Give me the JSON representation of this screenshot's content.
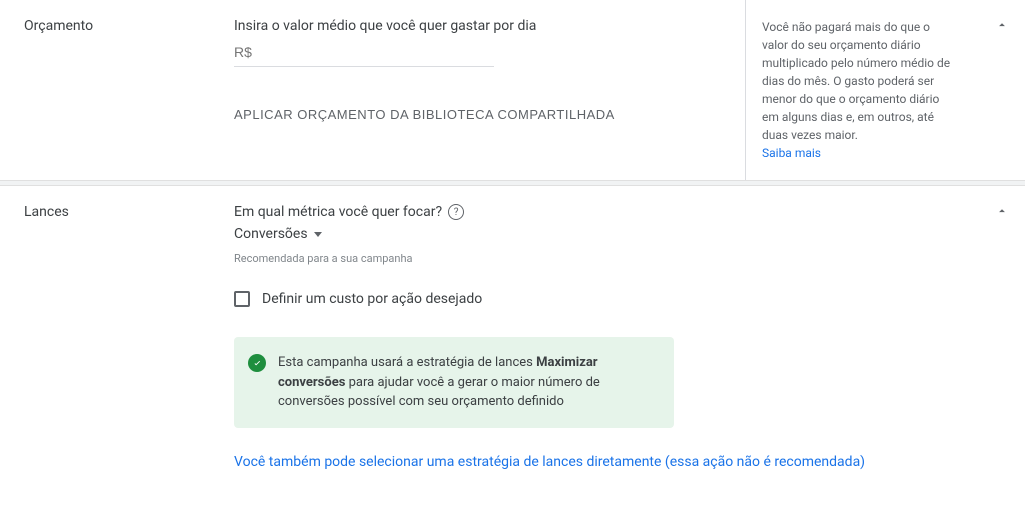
{
  "budget": {
    "label": "Orçamento",
    "field_label": "Insira o valor médio que você quer gastar por dia",
    "currency_prefix": "R$",
    "apply_library_btn": "APLICAR ORÇAMENTO DA BIBLIOTECA COMPARTILHADA",
    "help_text": "Você não pagará mais do que o valor do seu orçamento diário multiplicado pelo número médio de dias do mês. O gasto poderá ser menor do que o orçamento diário em alguns dias e, em outros, até duas vezes maior.",
    "learn_more": "Saiba mais"
  },
  "bidding": {
    "label": "Lances",
    "metric_question": "Em qual métrica você quer focar?",
    "selected_metric": "Conversões",
    "recommended_text": "Recomendada para a sua campanha",
    "cpa_checkbox_label": "Definir um custo por ação desejado",
    "info_prefix": "Esta campanha usará a estratégia de lances ",
    "info_bold": "Maximizar conversões",
    "info_suffix": " para ajudar você a gerar o maior número de conversões possível com seu orçamento definido",
    "alt_strategy_link": "Você também pode selecionar uma estratégia de lances diretamente (essa ação não é recomendada)"
  }
}
